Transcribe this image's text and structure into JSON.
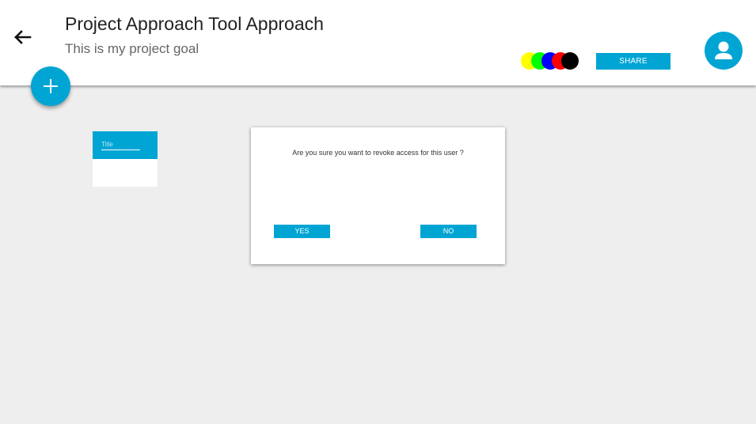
{
  "colors": {
    "accent": "#00A5D4",
    "header_bg": "#FFFFFF",
    "page_bg": "#EEEEEE"
  },
  "header": {
    "back_icon": "arrow-left-icon",
    "title": "Project Approach Tool Approach",
    "subtitle": "This is my project goal",
    "color_options": [
      "#FFFF00",
      "#00FF00",
      "#0000FF",
      "#FF0000",
      "#000000"
    ],
    "share_label": "SHARE",
    "avatar_icon": "user-icon"
  },
  "fab": {
    "icon": "plus-icon"
  },
  "card": {
    "title_placeholder": "Title"
  },
  "dialog": {
    "message": "Are you sure you want to revoke access for this user ?",
    "yes_label": "YES",
    "no_label": "NO"
  }
}
